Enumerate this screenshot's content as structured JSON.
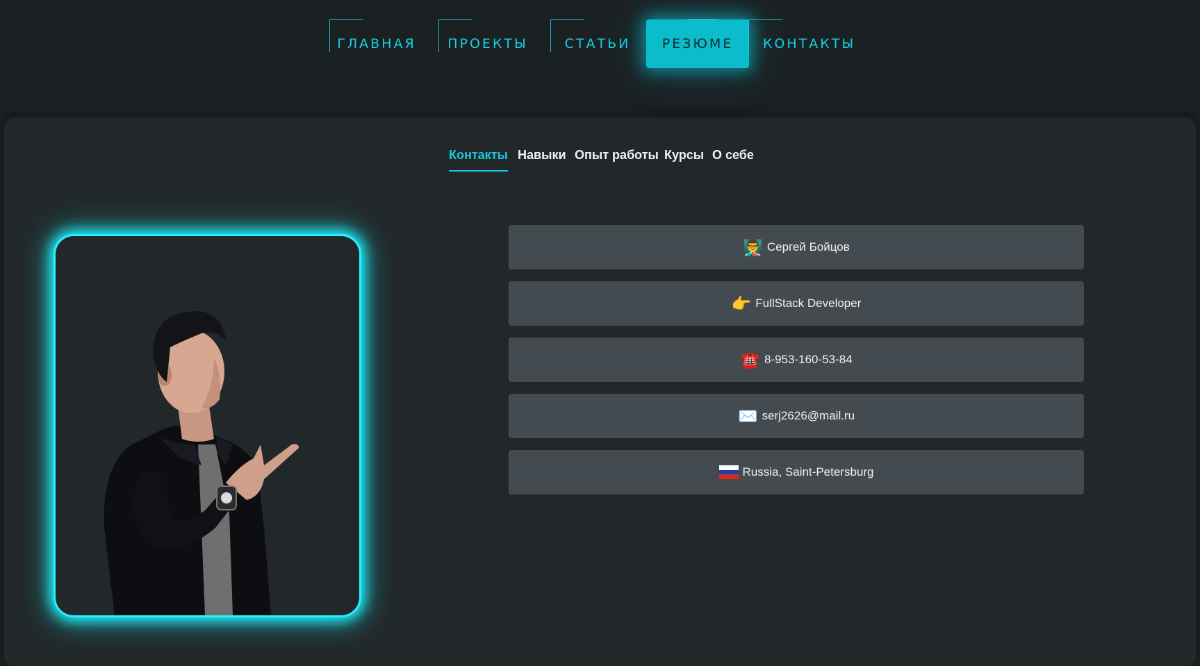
{
  "nav": {
    "items": [
      {
        "label": "ГЛАВНАЯ"
      },
      {
        "label": "ПРОЕКТЫ"
      },
      {
        "label": "СТАТЬИ"
      },
      {
        "label": "РЕЗЮМЕ"
      },
      {
        "label": "КОНТАКТЫ"
      }
    ],
    "active_index": 3
  },
  "tabs": {
    "items": [
      {
        "label": "Контакты"
      },
      {
        "label": "Навыки"
      },
      {
        "label": "Опыт работы"
      },
      {
        "label": "Курсы"
      },
      {
        "label": "О себе"
      }
    ],
    "active_index": 0
  },
  "contacts": [
    {
      "icon": "teacher-emoji-icon",
      "text": "Сергей Бойцов"
    },
    {
      "icon": "pointing-hand-emoji-icon",
      "text": "FullStack Developer"
    },
    {
      "icon": "telephone-emoji-icon",
      "text": "8-953-160-53-84"
    },
    {
      "icon": "envelope-emoji-icon",
      "text": "serj2626@mail.ru"
    },
    {
      "icon": "russia-flag-icon",
      "text": "Russia, Saint-Petersburg"
    }
  ],
  "colors": {
    "accent": "#14d0e3",
    "glow": "#1ff2ff",
    "background": "#1b2022",
    "panel": "#222829",
    "card": "#434a50"
  }
}
